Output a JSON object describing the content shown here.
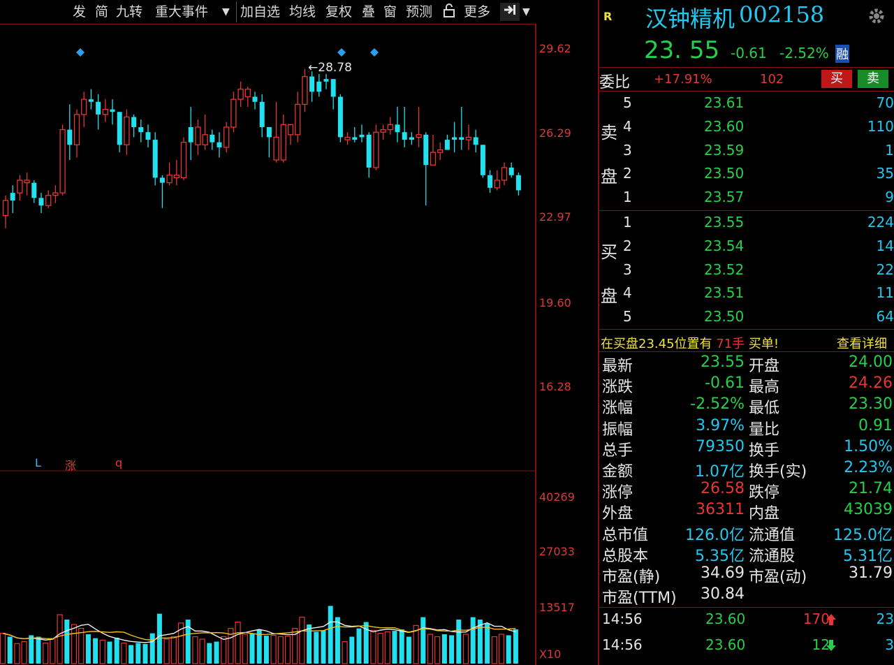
{
  "toolbar": {
    "items": [
      "发",
      "简",
      "九转",
      "重大事件",
      "加自选",
      "均线",
      "复权",
      "叠",
      "窗",
      "预测",
      "更多"
    ]
  },
  "chart": {
    "high_label": "28.78",
    "price_axis": [
      "29.62",
      "26.29",
      "22.97",
      "19.60",
      "16.28"
    ],
    "volume_axis": [
      "40269",
      "27033",
      "13517"
    ],
    "volume_unit": "X10",
    "marker_L": "L",
    "marker_zhang": "涨",
    "marker_q": "q",
    "candles": [
      [
        23.0,
        23.6,
        22.5,
        23.8,
        "red"
      ],
      [
        23.6,
        23.9,
        23.1,
        24.2,
        "cyan"
      ],
      [
        23.9,
        24.4,
        23.6,
        24.6,
        "red"
      ],
      [
        24.4,
        24.3,
        23.8,
        24.7,
        "red"
      ],
      [
        24.3,
        23.7,
        23.5,
        24.4,
        "cyan"
      ],
      [
        23.7,
        23.4,
        23.1,
        23.9,
        "cyan"
      ],
      [
        23.4,
        23.8,
        23.3,
        24.0,
        "red"
      ],
      [
        23.8,
        23.9,
        23.5,
        24.2,
        "red"
      ],
      [
        23.9,
        26.4,
        23.8,
        26.6,
        "red"
      ],
      [
        26.4,
        25.8,
        25.2,
        27.4,
        "cyan"
      ],
      [
        25.8,
        27.0,
        25.3,
        27.2,
        "red"
      ],
      [
        27.0,
        27.6,
        26.5,
        27.9,
        "red"
      ],
      [
        27.6,
        27.5,
        27.2,
        28.0,
        "cyan"
      ],
      [
        27.5,
        27.0,
        26.4,
        27.8,
        "cyan"
      ],
      [
        27.0,
        27.2,
        26.7,
        27.6,
        "red"
      ],
      [
        27.2,
        27.1,
        26.6,
        27.6,
        "cyan"
      ],
      [
        27.1,
        25.8,
        25.5,
        27.1,
        "cyan"
      ],
      [
        25.8,
        26.9,
        25.4,
        27.2,
        "red"
      ],
      [
        26.9,
        26.5,
        26.1,
        27.0,
        "cyan"
      ],
      [
        26.5,
        26.3,
        25.9,
        26.8,
        "cyan"
      ],
      [
        26.3,
        26.0,
        25.7,
        26.6,
        "cyan"
      ],
      [
        26.0,
        24.5,
        24.2,
        26.3,
        "cyan"
      ],
      [
        24.5,
        24.3,
        23.3,
        24.6,
        "cyan"
      ],
      [
        24.3,
        24.6,
        24.2,
        25.1,
        "red"
      ],
      [
        24.6,
        24.5,
        24.2,
        25.2,
        "red"
      ],
      [
        24.5,
        25.9,
        24.4,
        26.1,
        "red"
      ],
      [
        25.9,
        26.5,
        25.2,
        27.3,
        "cyan"
      ],
      [
        26.5,
        25.8,
        25.4,
        26.8,
        "red"
      ],
      [
        25.8,
        26.2,
        25.6,
        27.0,
        "red"
      ],
      [
        26.2,
        25.9,
        25.6,
        26.4,
        "cyan"
      ],
      [
        25.9,
        25.7,
        25.3,
        26.3,
        "cyan"
      ],
      [
        25.7,
        26.5,
        25.5,
        26.7,
        "red"
      ],
      [
        26.5,
        27.6,
        26.3,
        27.9,
        "red"
      ],
      [
        27.6,
        28.0,
        27.3,
        28.3,
        "red"
      ],
      [
        28.0,
        27.7,
        27.3,
        28.1,
        "red"
      ],
      [
        27.7,
        27.5,
        27.2,
        27.9,
        "cyan"
      ],
      [
        27.5,
        26.5,
        26.1,
        27.8,
        "cyan"
      ],
      [
        26.5,
        26.1,
        25.3,
        26.5,
        "cyan"
      ],
      [
        26.1,
        25.2,
        25.1,
        27.5,
        "red"
      ],
      [
        25.2,
        26.6,
        25.1,
        27.0,
        "red"
      ],
      [
        26.6,
        26.2,
        25.8,
        26.6,
        "red"
      ],
      [
        26.2,
        27.4,
        25.9,
        27.9,
        "red"
      ],
      [
        27.4,
        28.5,
        27.1,
        28.8,
        "red"
      ],
      [
        28.5,
        27.9,
        27.5,
        28.7,
        "cyan"
      ],
      [
        27.9,
        28.3,
        27.7,
        28.6,
        "cyan"
      ],
      [
        28.3,
        28.4,
        28.0,
        28.6,
        "cyan"
      ],
      [
        28.4,
        27.7,
        27.2,
        28.4,
        "cyan"
      ],
      [
        27.7,
        26.1,
        25.9,
        27.8,
        "cyan"
      ],
      [
        26.1,
        26.0,
        25.8,
        26.3,
        "red"
      ],
      [
        26.0,
        26.1,
        25.9,
        26.5,
        "cyan"
      ],
      [
        26.1,
        26.2,
        25.9,
        26.6,
        "cyan"
      ],
      [
        26.2,
        24.9,
        24.5,
        26.3,
        "cyan"
      ],
      [
        24.9,
        26.3,
        24.8,
        26.6,
        "red"
      ],
      [
        26.3,
        26.4,
        26.0,
        26.6,
        "red"
      ],
      [
        26.4,
        26.6,
        26.2,
        26.9,
        "red"
      ],
      [
        26.6,
        26.3,
        25.9,
        27.3,
        "cyan"
      ],
      [
        26.3,
        26.0,
        25.7,
        27.3,
        "cyan"
      ],
      [
        26.0,
        26.1,
        25.8,
        26.3,
        "cyan"
      ],
      [
        26.1,
        26.2,
        25.7,
        27.3,
        "red"
      ],
      [
        26.2,
        25.0,
        23.4,
        26.3,
        "cyan"
      ],
      [
        25.0,
        25.5,
        25.0,
        26.2,
        "red"
      ],
      [
        25.5,
        25.6,
        25.2,
        25.9,
        "red"
      ],
      [
        25.6,
        26.0,
        25.6,
        26.2,
        "cyan"
      ],
      [
        26.0,
        26.1,
        25.5,
        26.7,
        "cyan"
      ],
      [
        26.1,
        26.0,
        25.6,
        27.3,
        "cyan"
      ],
      [
        26.0,
        26.1,
        25.6,
        26.6,
        "red"
      ],
      [
        26.1,
        25.8,
        25.5,
        26.4,
        "cyan"
      ],
      [
        25.8,
        24.6,
        24.5,
        25.8,
        "cyan"
      ],
      [
        24.6,
        24.1,
        23.9,
        24.8,
        "cyan"
      ],
      [
        24.1,
        24.4,
        24.0,
        24.8,
        "red"
      ],
      [
        24.4,
        24.9,
        24.2,
        25.1,
        "red"
      ],
      [
        24.9,
        24.6,
        24.5,
        25.1,
        "cyan"
      ],
      [
        24.6,
        24.0,
        23.8,
        24.7,
        "cyan"
      ]
    ],
    "volumes": [
      [
        0.62,
        "red"
      ],
      [
        0.55,
        "cyan"
      ],
      [
        0.41,
        "red"
      ],
      [
        0.45,
        "red"
      ],
      [
        0.58,
        "cyan"
      ],
      [
        0.55,
        "cyan"
      ],
      [
        0.42,
        "red"
      ],
      [
        0.5,
        "red"
      ],
      [
        1.0,
        "red"
      ],
      [
        0.9,
        "cyan"
      ],
      [
        0.8,
        "red"
      ],
      [
        0.72,
        "red"
      ],
      [
        0.6,
        "cyan"
      ],
      [
        0.52,
        "cyan"
      ],
      [
        0.48,
        "red"
      ],
      [
        0.45,
        "cyan"
      ],
      [
        0.53,
        "cyan"
      ],
      [
        0.42,
        "red"
      ],
      [
        0.38,
        "cyan"
      ],
      [
        0.42,
        "cyan"
      ],
      [
        0.4,
        "cyan"
      ],
      [
        0.62,
        "cyan"
      ],
      [
        1.02,
        "cyan"
      ],
      [
        0.5,
        "red"
      ],
      [
        0.55,
        "red"
      ],
      [
        0.83,
        "red"
      ],
      [
        0.9,
        "cyan"
      ],
      [
        0.55,
        "red"
      ],
      [
        0.5,
        "red"
      ],
      [
        0.42,
        "cyan"
      ],
      [
        0.45,
        "cyan"
      ],
      [
        0.55,
        "red"
      ],
      [
        0.72,
        "red"
      ],
      [
        0.85,
        "red"
      ],
      [
        0.6,
        "red"
      ],
      [
        0.62,
        "cyan"
      ],
      [
        0.7,
        "cyan"
      ],
      [
        0.57,
        "cyan"
      ],
      [
        0.58,
        "red"
      ],
      [
        0.55,
        "red"
      ],
      [
        0.56,
        "red"
      ],
      [
        0.72,
        "red"
      ],
      [
        0.95,
        "red"
      ],
      [
        0.8,
        "cyan"
      ],
      [
        0.65,
        "cyan"
      ],
      [
        0.68,
        "cyan"
      ],
      [
        1.18,
        "cyan"
      ],
      [
        0.95,
        "cyan"
      ],
      [
        0.45,
        "red"
      ],
      [
        0.55,
        "cyan"
      ],
      [
        0.72,
        "cyan"
      ],
      [
        0.85,
        "cyan"
      ],
      [
        0.68,
        "red"
      ],
      [
        0.62,
        "red"
      ],
      [
        0.65,
        "red"
      ],
      [
        0.67,
        "cyan"
      ],
      [
        0.7,
        "cyan"
      ],
      [
        0.55,
        "cyan"
      ],
      [
        0.78,
        "red"
      ],
      [
        0.95,
        "cyan"
      ],
      [
        0.6,
        "red"
      ],
      [
        0.55,
        "red"
      ],
      [
        0.6,
        "cyan"
      ],
      [
        0.58,
        "cyan"
      ],
      [
        0.9,
        "cyan"
      ],
      [
        0.6,
        "red"
      ],
      [
        0.95,
        "cyan"
      ],
      [
        0.9,
        "cyan"
      ],
      [
        0.82,
        "cyan"
      ],
      [
        0.55,
        "red"
      ],
      [
        0.6,
        "red"
      ],
      [
        0.58,
        "cyan"
      ],
      [
        0.7,
        "cyan"
      ]
    ]
  },
  "quote": {
    "badge": "R",
    "name": "汉钟精机",
    "code": "002158",
    "price": "23. 55",
    "change": "-0.61",
    "change_pct": "-2.52%",
    "tag": "融"
  },
  "weibi": {
    "label": "委比",
    "value": "+17.91%",
    "diff": "102",
    "buy": "买",
    "sell": "卖"
  },
  "sell_orders": [
    {
      "level": "5",
      "price": "23.61",
      "vol": "70"
    },
    {
      "level": "4",
      "price": "23.60",
      "vol": "110"
    },
    {
      "level": "3",
      "price": "23.59",
      "vol": "1"
    },
    {
      "level": "2",
      "price": "23.50",
      "vol": "35"
    },
    {
      "level": "1",
      "price": "23.57",
      "vol": "9"
    }
  ],
  "buy_orders": [
    {
      "level": "1",
      "price": "23.55",
      "vol": "224"
    },
    {
      "level": "2",
      "price": "23.54",
      "vol": "14"
    },
    {
      "level": "3",
      "price": "23.52",
      "vol": "22"
    },
    {
      "level": "4",
      "price": "23.51",
      "vol": "11"
    },
    {
      "level": "5",
      "price": "23.50",
      "vol": "64"
    }
  ],
  "side_labels": {
    "sell1": "卖",
    "sell2": "盘",
    "buy1": "买",
    "buy2": "盘"
  },
  "notice": {
    "prefix": "在买盘23.45位置有",
    "hands": "71手",
    "suffix": "买单!",
    "link": "查看详细"
  },
  "stats": [
    {
      "l1": "最新",
      "v1": "23.55",
      "c1": "gr",
      "l2": "开盘",
      "v2": "24.00",
      "c2": "gr"
    },
    {
      "l1": "涨跌",
      "v1": "-0.61",
      "c1": "gr",
      "l2": "最高",
      "v2": "24.26",
      "c2": "rd"
    },
    {
      "l1": "涨幅",
      "v1": "-2.52%",
      "c1": "gr",
      "l2": "最低",
      "v2": "23.30",
      "c2": "gr"
    },
    {
      "l1": "振幅",
      "v1": "3.97%",
      "c1": "cy",
      "l2": "量比",
      "v2": "0.91",
      "c2": "gr"
    },
    {
      "l1": "总手",
      "v1": "79350",
      "c1": "cy",
      "l2": "换手",
      "v2": "1.50%",
      "c2": "cy"
    },
    {
      "l1": "金额",
      "v1": "1.07亿",
      "c1": "cy",
      "l2": "换手(实)",
      "v2": "2.23%",
      "c2": "cy"
    },
    {
      "l1": "涨停",
      "v1": "26.58",
      "c1": "rd",
      "l2": "跌停",
      "v2": "21.74",
      "c2": "gr"
    },
    {
      "l1": "外盘",
      "v1": "36311",
      "c1": "rd",
      "l2": "内盘",
      "v2": "43039",
      "c2": "gr"
    },
    {
      "l1": "总市值",
      "v1": "126.0亿",
      "c1": "cy",
      "l2": "流通值",
      "v2": "125.0亿",
      "c2": "cy"
    },
    {
      "l1": "总股本",
      "v1": "5.35亿",
      "c1": "cy",
      "l2": "流通股",
      "v2": "5.31亿",
      "c2": "cy"
    },
    {
      "l1": "市盈(静)",
      "v1": "34.69",
      "c1": "wt",
      "l2": "市盈(动)",
      "v2": "31.79",
      "c2": "wt"
    },
    {
      "l1": "市盈(TTM)",
      "v1": "30.84",
      "c1": "wt",
      "l2": "",
      "v2": "",
      "c2": "wt"
    }
  ],
  "ticks": [
    {
      "time": "14:56",
      "price": "23.60",
      "vol": "170",
      "dir": "up",
      "count": "23"
    },
    {
      "time": "14:56",
      "price": "23.60",
      "vol": "12",
      "dir": "down",
      "count": "3"
    }
  ],
  "colors": {
    "up": "#e83535",
    "down": "#22e0ee",
    "accent": "#22c8f0",
    "border": "#8a1010"
  },
  "icons": {
    "lock": "lock-icon",
    "exit": "exit-icon",
    "settings": "gear-icon"
  }
}
